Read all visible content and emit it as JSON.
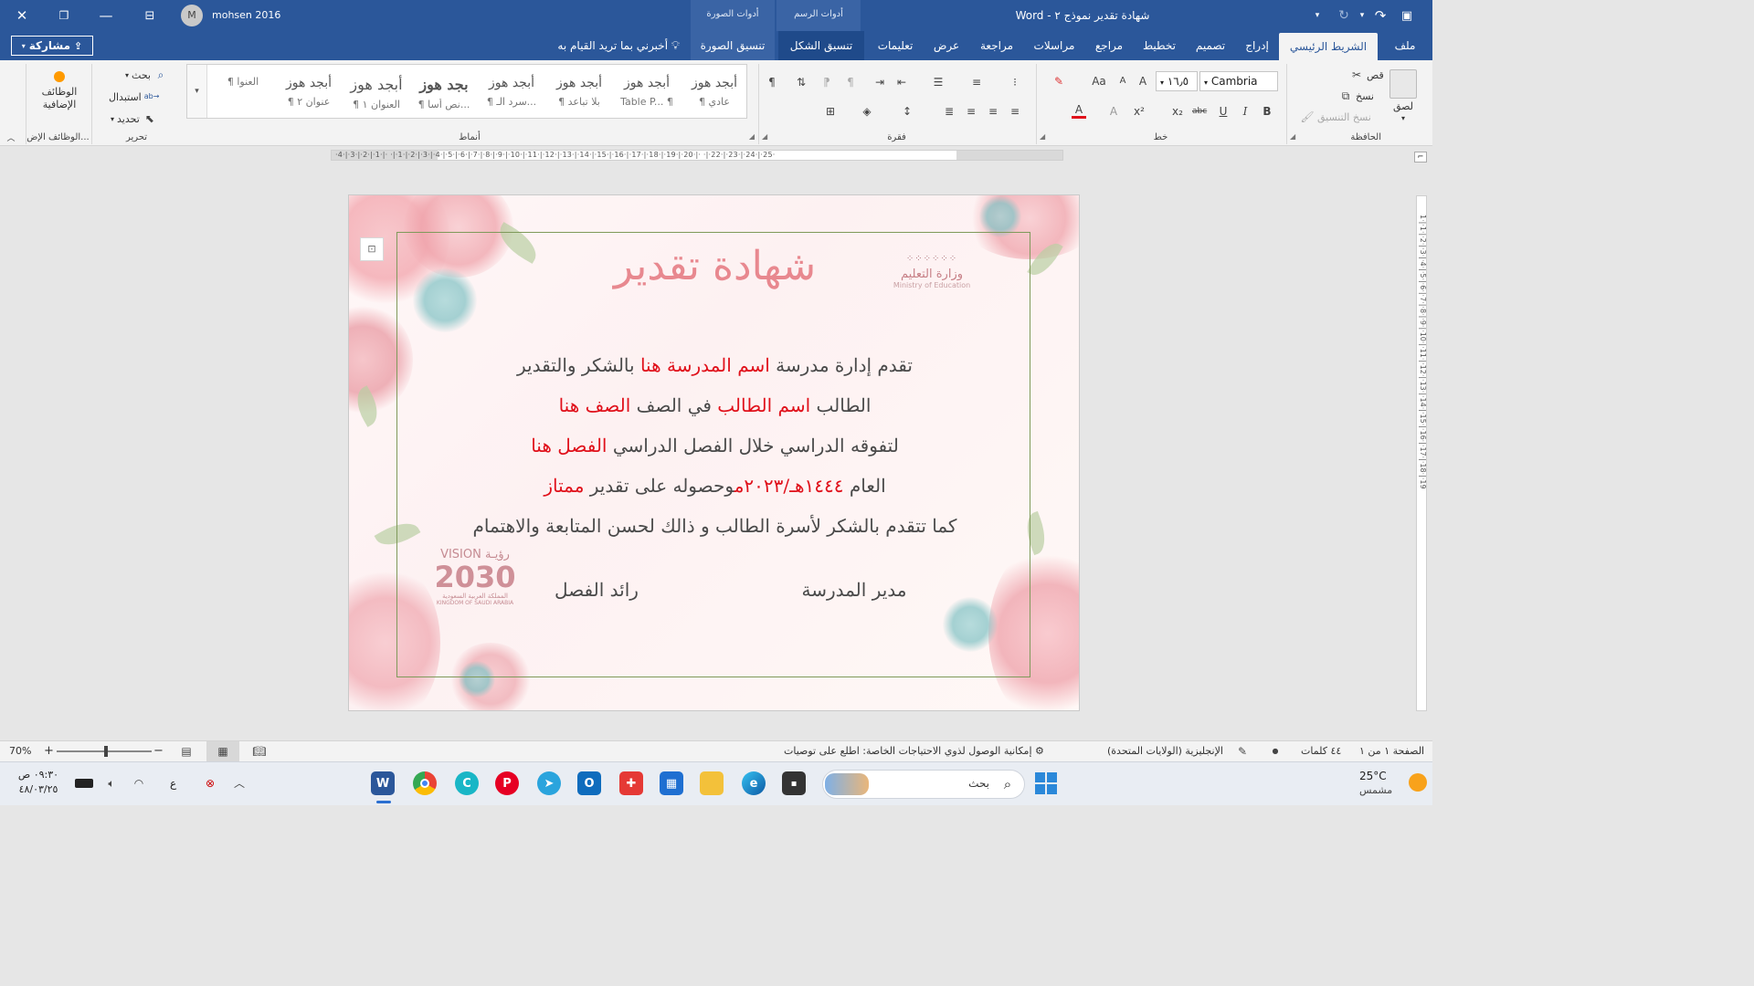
{
  "titlebar": {
    "doc_title": "شهادة تقدير نموذج ٢",
    "separator": "-",
    "app_name": "Word",
    "user_name": "mohsen 2016",
    "avatar_initial": "M",
    "ctx_picture": "أدوات الصورة",
    "ctx_drawing": "أدوات الرسم"
  },
  "tabs": {
    "file": "ملف",
    "home": "الشريط الرئيسي",
    "insert": "إدراج",
    "design": "تصميم",
    "layout": "تخطيط",
    "references": "مراجع",
    "mailings": "مراسلات",
    "review": "مراجعة",
    "view": "عرض",
    "help": "تعليمات",
    "shape_format": "تنسيق الشكل",
    "picture_format": "تنسيق الصورة",
    "tell_me": "أخبرني بما تريد القيام به",
    "share": "مشاركة"
  },
  "clipboard": {
    "label": "الحافظة",
    "paste": "لصق",
    "cut": "قص",
    "copy": "نسخ",
    "format_painter": "نسخ التنسيق"
  },
  "font": {
    "label": "خط",
    "name": "Cambria",
    "size": "١٦٫٥"
  },
  "paragraph": {
    "label": "فقرة"
  },
  "styles": {
    "label": "أنماط",
    "items": [
      {
        "sample": "أبجد هوز",
        "name": "¶ عادي"
      },
      {
        "sample": "أبجد هوز",
        "name": "Table P... ¶"
      },
      {
        "sample": "أبجد هوز",
        "name": "¶ بلا تباعد"
      },
      {
        "sample": "أبجد هوز",
        "name": "¶ سرد الـ..."
      },
      {
        "sample": "بجد هوز",
        "name": "¶ نص أسا..."
      },
      {
        "sample": "أبجد هوز",
        "name": "¶ العنوان ١"
      },
      {
        "sample": "أبجد هوز",
        "name": "¶ عنوان ٢"
      },
      {
        "sample": "",
        "name": "¶ العنوا"
      }
    ]
  },
  "editing": {
    "label": "تحرير",
    "find": "بحث",
    "replace": "استبدال",
    "select": "تحديد"
  },
  "addins": {
    "label": "الوظائف الإض...",
    "button": "الوظائف الإضافية"
  },
  "ruler": {
    "numbers": "·4·|·3·|·2·|·1·|· ·|·1·|·2·|·3·|·4·|·5·|·6·|·7·|·8·|·9·|·10·|·11·|·12·|·13·|·14·|·15·|·16·|·17·|·18·|·19·|·20·|· ·|·22·|·23·|·24·|·25·",
    "vertical_numbers": "1·|·1·|·2·|·3·|·4·|·5·|·6·|·7·|·8·|·9·|·10·|·11·|·12·|·13·|·14·|·15·|·16·|·17·|·18·|·19"
  },
  "document": {
    "title": "شهادة تقدير",
    "line1": {
      "a": "تقدم إدارة مدرسة ",
      "school": "اسم المدرسة هنا",
      "b": "  بالشكر والتقدير"
    },
    "line2": {
      "a": "الطالب ",
      "student": "اسم الطالب",
      "b": "  في الصف ",
      "grade": "الصف هنا"
    },
    "line3": {
      "a": "لتفوقه الدراسي خلال الفصل الدراسي ",
      "term": "الفصل هنا"
    },
    "line4": {
      "a": "العام ",
      "year": "١٤٤٤هـ/٢٠٢٣م",
      "b": "وحصوله على تقدير ",
      "grade_val": "ممتاز"
    },
    "line5": "كما تتقدم بالشكر لأسرة الطالب و ذالك لحسن المتابعة والاهتمام",
    "sign_principal": "مدير المدرسة",
    "sign_teacher": "رائد الفصل",
    "moe_ar": "وزارة التعليم",
    "moe_en": "Ministry of Education",
    "vision_ar_word": "رؤيـة",
    "vision_en_word": "VISION",
    "vision_year": "2030",
    "vision_country_ar": "المملكة العربية السعودية",
    "vision_country_en": "KINGDOM OF SAUDI ARABIA"
  },
  "statusbar": {
    "page": "الصفحة ١ من ١",
    "words": "٤٤ كلمات",
    "language": "الإنجليزية (الولايات المتحدة)",
    "accessibility": "إمكانية الوصول لذوي الاحتياجات الخاصة: اطلع على توصيات",
    "zoom": "70%",
    "zoom_plus": "+",
    "zoom_minus": "−",
    "zoom_fraction": 0.52
  },
  "taskbar": {
    "weather_temp": "25°C",
    "weather_desc": "مشمس",
    "search_placeholder": "بحث",
    "time": "٠٩:٣٠ ص",
    "date": "٤٨/٠٣/٢٥",
    "lang": "ع"
  },
  "colors": {
    "word_blue": "#2b579a",
    "title_pink": "#e8888f",
    "placeholder_red": "#e0111b",
    "frame_green": "#7f9a5a"
  }
}
